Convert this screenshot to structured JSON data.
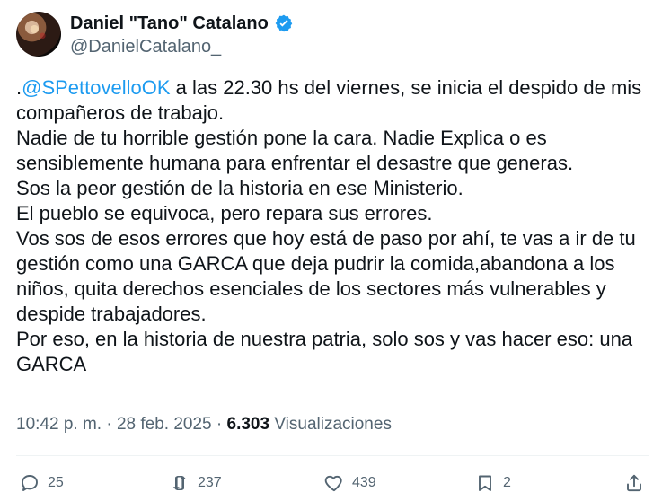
{
  "author": {
    "name": "Daniel \"Tano\" Catalano",
    "handle": "@DanielCatalano_",
    "verified_icon": "verified-badge-icon",
    "avatar": "avatar"
  },
  "tweet": {
    "mention": "@SPettovelloOK",
    "lead": ".",
    "line1": " a las 22.30 hs del viernes, se inicia el despido de mis compañeros de trabajo.",
    "line2": "Nadie de tu horrible gestión pone la cara. Nadie Explica o es sensiblemente humana para enfrentar el desastre que generas.",
    "line3": "Sos la peor gestión de la historia en ese Ministerio.",
    "line4": "El pueblo se equivoca, pero repara sus errores.",
    "line5": "Vos sos de esos errores que hoy está de paso por ahí, te vas a ir de tu gestión como una GARCA que deja pudrir la comida,abandona a los niños, quita derechos esenciales de los sectores más vulnerables y despide trabajadores.",
    "line6": "Por eso, en la historia de nuestra patria, solo sos y vas hacer eso: una GARCA"
  },
  "meta": {
    "time": "10:42 p. m.",
    "sep1": " · ",
    "date": "28 feb. 2025",
    "sep2": " · ",
    "views_count": "6.303",
    "views_label": " Visualizaciones"
  },
  "actions": {
    "reply_icon": "reply-icon",
    "reply_count": "25",
    "retweet_icon": "retweet-icon",
    "retweet_count": "237",
    "like_icon": "heart-icon",
    "like_count": "439",
    "bookmark_icon": "bookmark-icon",
    "bookmark_count": "2",
    "share_icon": "share-icon"
  },
  "colors": {
    "text": "#0f1419",
    "secondary": "#536471",
    "accent": "#1d9bf0"
  }
}
